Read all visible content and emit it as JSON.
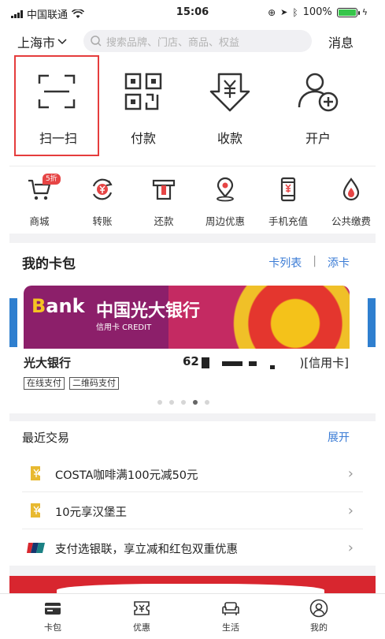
{
  "status_bar": {
    "carrier": "中国联通",
    "time": "15:06",
    "battery": "100%",
    "colors": {
      "battery": "#36c54a"
    }
  },
  "header": {
    "city": "上海市",
    "search_placeholder": "搜索品牌、门店、商品、权益",
    "messages": "消息"
  },
  "quick_actions": [
    {
      "label": "扫一扫",
      "icon": "scan-icon"
    },
    {
      "label": "付款",
      "icon": "qr-code-icon"
    },
    {
      "label": "收款",
      "icon": "yuan-receive-icon"
    },
    {
      "label": "开户",
      "icon": "add-user-icon"
    }
  ],
  "services": [
    {
      "label": "商城",
      "icon": "cart-icon",
      "badge": "5折"
    },
    {
      "label": "转账",
      "icon": "transfer-icon"
    },
    {
      "label": "还款",
      "icon": "repay-icon"
    },
    {
      "label": "周边优惠",
      "icon": "location-icon"
    },
    {
      "label": "手机充值",
      "icon": "phone-recharge-icon"
    },
    {
      "label": "公共缴费",
      "icon": "water-drop-icon"
    }
  ],
  "card_pack": {
    "title": "我的卡包",
    "card_list": "卡列表",
    "divider": "|",
    "add_card": "添卡",
    "card": {
      "logo_prefix": "B",
      "logo_rest": "ank",
      "bank_name": "中国光大银行",
      "credit_label": "信用卡 CREDIT",
      "name": "光大银行",
      "number_prefix": "62",
      "type": ")[信用卡]",
      "tags": [
        "在线支付",
        "二维码支付"
      ]
    },
    "pagination": {
      "count": 5,
      "active": 4
    },
    "colors": {
      "card_bg": "#8c1f6a",
      "link": "#3a7bd5"
    }
  },
  "recent": {
    "title": "最近交易",
    "expand": "展开",
    "items": [
      {
        "text": "COSTA咖啡满100元减50元",
        "icon": "coupon-icon"
      },
      {
        "text": "10元享汉堡王",
        "icon": "coupon-icon"
      },
      {
        "text": "支付选银联，享立减和红包双重优惠",
        "icon": "unionpay-icon"
      }
    ]
  },
  "tab_bar": [
    {
      "label": "卡包",
      "icon": "card-icon"
    },
    {
      "label": "优惠",
      "icon": "coupon-tab-icon"
    },
    {
      "label": "生活",
      "icon": "sofa-icon"
    },
    {
      "label": "我的",
      "icon": "user-icon"
    }
  ]
}
